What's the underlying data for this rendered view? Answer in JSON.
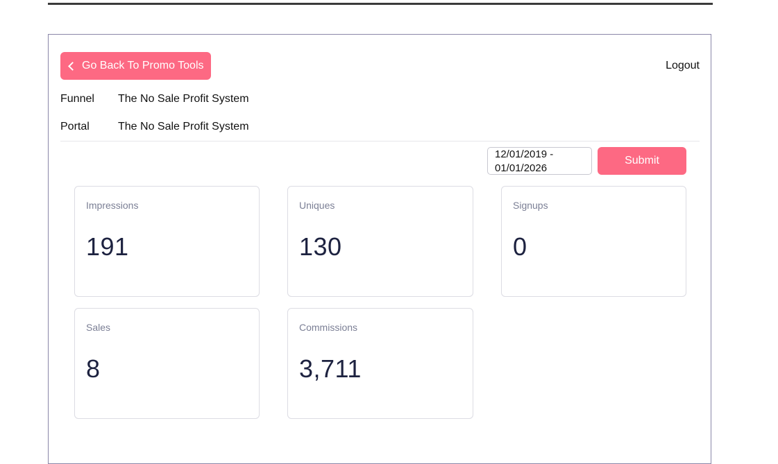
{
  "header": {
    "back_button_label": "Go Back To Promo Tools",
    "logout_label": "Logout"
  },
  "meta": {
    "funnel_label": "Funnel",
    "funnel_value": "The No Sale Profit System",
    "portal_label": "Portal",
    "portal_value": "The No Sale Profit System"
  },
  "filter": {
    "date_range_value": "12/01/2019 - 01/01/2026",
    "submit_label": "Submit"
  },
  "stats": [
    {
      "label": "Impressions",
      "value": "191"
    },
    {
      "label": "Uniques",
      "value": "130"
    },
    {
      "label": "Signups",
      "value": "0"
    },
    {
      "label": "Sales",
      "value": "8"
    },
    {
      "label": "Commissions",
      "value": "3,711"
    }
  ],
  "colors": {
    "accent": "#fd6983",
    "stat_value": "#1d2240",
    "stat_label": "#7b7f95"
  },
  "icons": {
    "back": "chevron-left-icon"
  }
}
